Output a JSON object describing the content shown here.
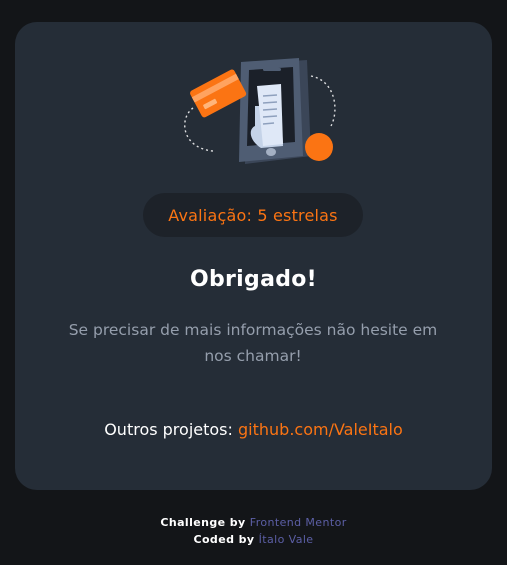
{
  "card": {
    "rating_label": "Avaliação: 5 estrelas",
    "title": "Obrigado!",
    "message": "Se precisar de mais informações não hesite em nos chamar!",
    "projects_label": "Outros projetos:",
    "projects_link": "github.com/ValeItalo"
  },
  "footer": {
    "challenge_prefix": "Challenge by",
    "challenge_link": "Frontend Mentor",
    "coded_prefix": "Coded by",
    "coded_link": "Ítalo Vale"
  },
  "colors": {
    "page_bg": "#131518",
    "card_bg": "#252d37",
    "pill_bg": "#1d2229",
    "accent_orange": "#fb7413",
    "muted_text": "#959eac",
    "footer_link": "#5c5fa6"
  },
  "icons": {
    "illustration": "payment-phone-illustration"
  }
}
